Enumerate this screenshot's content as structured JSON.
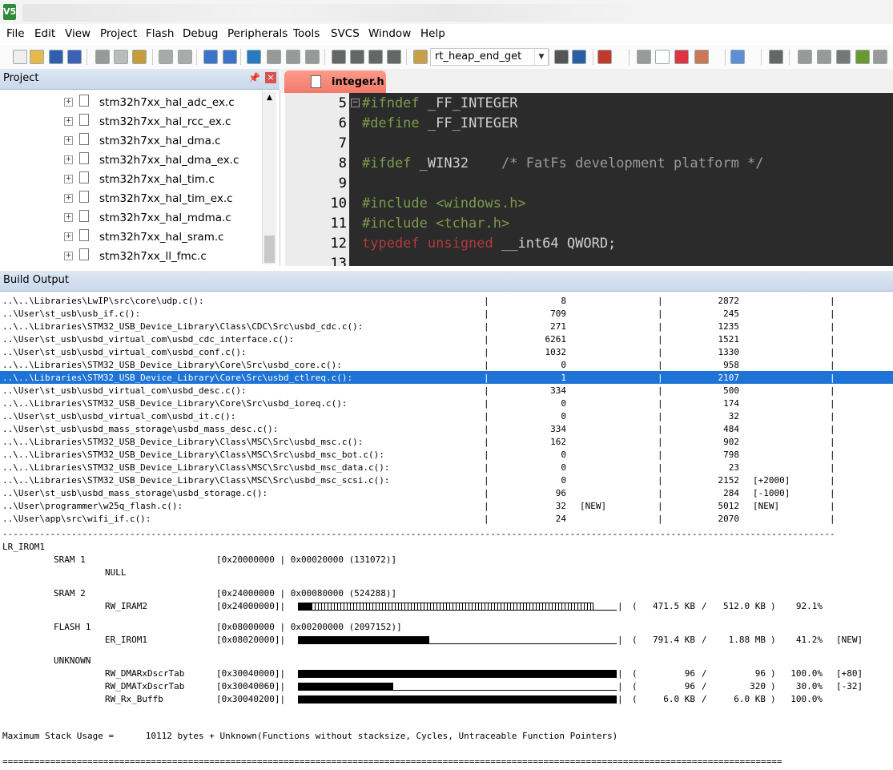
{
  "window": {
    "app_icon": "V5"
  },
  "menu": [
    "File",
    "Edit",
    "View",
    "Project",
    "Flash",
    "Debug",
    "Peripherals",
    "Tools",
    "SVCS",
    "Window",
    "Help"
  ],
  "toolbar": {
    "find_combo": "rt_heap_end_get"
  },
  "project": {
    "title": "Project",
    "files": [
      "stm32h7xx_hal_adc_ex.c",
      "stm32h7xx_hal_rcc_ex.c",
      "stm32h7xx_hal_dma.c",
      "stm32h7xx_hal_dma_ex.c",
      "stm32h7xx_hal_tim.c",
      "stm32h7xx_hal_tim_ex.c",
      "stm32h7xx_hal_mdma.c",
      "stm32h7xx_hal_sram.c",
      "stm32h7xx_ll_fmc.c"
    ]
  },
  "editor": {
    "tab": "integer.h",
    "lines": [
      {
        "n": "5",
        "parts": [
          [
            "pp",
            "#ifndef "
          ],
          [
            "txt",
            "_FF_INTEGER"
          ]
        ]
      },
      {
        "n": "6",
        "parts": [
          [
            "pp",
            "#define "
          ],
          [
            "txt",
            "_FF_INTEGER"
          ]
        ]
      },
      {
        "n": "7",
        "parts": []
      },
      {
        "n": "8",
        "parts": [
          [
            "pp",
            "#ifdef "
          ],
          [
            "txt",
            "_WIN32    "
          ],
          [
            "cm",
            "/* FatFs development platform */"
          ]
        ]
      },
      {
        "n": "9",
        "parts": []
      },
      {
        "n": "10",
        "parts": [
          [
            "pp",
            "#include <windows.h>"
          ]
        ]
      },
      {
        "n": "11",
        "parts": [
          [
            "pp",
            "#include <tchar.h>"
          ]
        ]
      },
      {
        "n": "12",
        "parts": [
          [
            "kw",
            "typedef unsigned "
          ],
          [
            "txt",
            "__int64 QWORD;"
          ]
        ]
      },
      {
        "n": "13",
        "parts": []
      }
    ]
  },
  "build": {
    "title": "Build Output",
    "rows": [
      {
        "file": "..\\..\\Libraries\\LwIP\\src\\core\\udp.c():",
        "a": "8",
        "an": "",
        "b": "2872",
        "bn": ""
      },
      {
        "file": "..\\User\\st_usb\\usb_if.c():",
        "a": "709",
        "an": "",
        "b": "245",
        "bn": ""
      },
      {
        "file": "..\\..\\Libraries\\STM32_USB_Device_Library\\Class\\CDC\\Src\\usbd_cdc.c():",
        "a": "271",
        "an": "",
        "b": "1235",
        "bn": ""
      },
      {
        "file": "..\\User\\st_usb\\usbd_virtual_com\\usbd_cdc_interface.c():",
        "a": "6261",
        "an": "",
        "b": "1521",
        "bn": ""
      },
      {
        "file": "..\\User\\st_usb\\usbd_virtual_com\\usbd_conf.c():",
        "a": "1032",
        "an": "",
        "b": "1330",
        "bn": ""
      },
      {
        "file": "..\\..\\Libraries\\STM32_USB_Device_Library\\Core\\Src\\usbd_core.c():",
        "a": "0",
        "an": "",
        "b": "958",
        "bn": ""
      },
      {
        "file": "..\\..\\Libraries\\STM32_USB_Device_Library\\Core\\Src\\usbd_ctlreq.c():",
        "a": "1",
        "an": "",
        "b": "2107",
        "bn": "",
        "selected": true
      },
      {
        "file": "..\\User\\st_usb\\usbd_virtual_com\\usbd_desc.c():",
        "a": "334",
        "an": "",
        "b": "500",
        "bn": ""
      },
      {
        "file": "..\\..\\Libraries\\STM32_USB_Device_Library\\Core\\Src\\usbd_ioreq.c():",
        "a": "0",
        "an": "",
        "b": "174",
        "bn": ""
      },
      {
        "file": "..\\User\\st_usb\\usbd_virtual_com\\usbd_it.c():",
        "a": "0",
        "an": "",
        "b": "32",
        "bn": ""
      },
      {
        "file": "..\\User\\st_usb\\usbd_mass_storage\\usbd_mass_desc.c():",
        "a": "334",
        "an": "",
        "b": "484",
        "bn": ""
      },
      {
        "file": "..\\..\\Libraries\\STM32_USB_Device_Library\\Class\\MSC\\Src\\usbd_msc.c():",
        "a": "162",
        "an": "",
        "b": "902",
        "bn": ""
      },
      {
        "file": "..\\..\\Libraries\\STM32_USB_Device_Library\\Class\\MSC\\Src\\usbd_msc_bot.c():",
        "a": "0",
        "an": "",
        "b": "798",
        "bn": ""
      },
      {
        "file": "..\\..\\Libraries\\STM32_USB_Device_Library\\Class\\MSC\\Src\\usbd_msc_data.c():",
        "a": "0",
        "an": "",
        "b": "23",
        "bn": ""
      },
      {
        "file": "..\\..\\Libraries\\STM32_USB_Device_Library\\Class\\MSC\\Src\\usbd_msc_scsi.c():",
        "a": "0",
        "an": "",
        "b": "2152",
        "bn": "[+2000]"
      },
      {
        "file": "..\\User\\st_usb\\usbd_mass_storage\\usbd_storage.c():",
        "a": "96",
        "an": "",
        "b": "284",
        "bn": "[-1000]"
      },
      {
        "file": "..\\User\\programmer\\w25q_flash.c():",
        "a": "32",
        "an": "[NEW]",
        "b": "5012",
        "bn": "[NEW]"
      },
      {
        "file": "..\\User\\app\\src\\wifi_if.c():",
        "a": "24",
        "an": "",
        "b": "2070",
        "bn": ""
      }
    ],
    "separator": "-------------------------------------------------------------------------------------------------------------------------------------------------------------------------------",
    "region": "LR_IROM1",
    "mem": [
      {
        "name": "SRAM 1",
        "range": "[0x20000000 | 0x00020000 (131072)]",
        "sections": [
          {
            "label": "NULL"
          }
        ]
      },
      {
        "name": "SRAM 2",
        "range": "[0x24000000 | 0x00080000 (524288)]",
        "sections": [
          {
            "label": "RW_IRAM2",
            "addr": "[0x24000000]|",
            "used": "471.5 KB",
            "total": "512.0 KB",
            "pct": "92.1%",
            "fill": 0.921,
            "mark": "",
            "style": "ticks"
          }
        ]
      },
      {
        "name": "FLASH 1",
        "range": "[0x08000000 | 0x00200000 (2097152)]",
        "sections": [
          {
            "label": "ER_IROM1",
            "addr": "[0x08020000]|",
            "used": "791.4 KB",
            "total": "1.88 MB",
            "pct": "41.2%",
            "fill": 0.412,
            "mark": "[NEW]",
            "style": "solid"
          }
        ]
      },
      {
        "name": "UNKNOWN",
        "range": "",
        "sections": [
          {
            "label": "RW_DMARxDscrTab",
            "addr": "[0x30040000]|",
            "used": "96",
            "total": "96",
            "pct": "100.0%",
            "fill": 1.0,
            "mark": "[+80]",
            "style": "solid"
          },
          {
            "label": "RW_DMATxDscrTab",
            "addr": "[0x30040060]|",
            "used": "96",
            "total": "320",
            "pct": "30.0%",
            "fill": 0.3,
            "mark": "[-32]",
            "style": "solid"
          },
          {
            "label": "RW_Rx_Buffb",
            "addr": "[0x30040200]|",
            "used": "6.0 KB",
            "total": "6.0 KB",
            "pct": "100.0%",
            "fill": 1.0,
            "mark": "",
            "style": "solid"
          }
        ]
      }
    ],
    "stack": "Maximum Stack Usage =      10112 bytes + Unknown(Functions without stacksize, Cycles, Untraceable Function Pointers)",
    "end_rule": "==================================================================================================================================================="
  }
}
